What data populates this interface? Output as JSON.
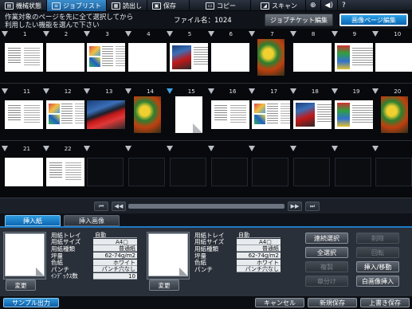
{
  "topbar": {
    "tabs": [
      {
        "label": "機械状態",
        "icon": "machine-status-icon"
      },
      {
        "label": "ジョブリスト",
        "icon": "job-list-icon"
      },
      {
        "label": "読出し",
        "icon": "recall-icon"
      },
      {
        "label": "保存",
        "icon": "save-icon"
      },
      {
        "label": "コピー",
        "icon": "copy-icon"
      },
      {
        "label": "スキャン",
        "icon": "scan-icon"
      }
    ],
    "globe_icon": "globe-icon",
    "volume_icon": "volume-icon",
    "help_icon": "help-icon"
  },
  "message": {
    "line1": "作業対象のページを先に全て選択してから",
    "line2": "利用したい機能を選んで下さい"
  },
  "file_name": "ファイル名：1024",
  "header_buttons": {
    "job_ticket": "ジョブチケット編集",
    "image_page": "画像ページ編集"
  },
  "pages": [
    {
      "num": "1",
      "kind": "text"
    },
    {
      "num": "2",
      "kind": "blank"
    },
    {
      "num": "3",
      "kind": "mix"
    },
    {
      "num": "4",
      "kind": "blank"
    },
    {
      "num": "5",
      "kind": "cartext"
    },
    {
      "num": "6",
      "kind": "blank"
    },
    {
      "num": "7",
      "kind": "dragon"
    },
    {
      "num": "8",
      "kind": "blank"
    },
    {
      "num": "9",
      "kind": "photoleft"
    },
    {
      "num": "10",
      "kind": "blank"
    },
    {
      "num": "11",
      "kind": "text"
    },
    {
      "num": "12",
      "kind": "mix"
    },
    {
      "num": "13",
      "kind": "car"
    },
    {
      "num": "14",
      "kind": "dragon"
    },
    {
      "num": "15",
      "kind": "curl"
    },
    {
      "num": "16",
      "kind": "text"
    },
    {
      "num": "17",
      "kind": "mix"
    },
    {
      "num": "18",
      "kind": "cartext"
    },
    {
      "num": "19",
      "kind": "photoleft"
    },
    {
      "num": "20",
      "kind": "dragon"
    },
    {
      "num": "21",
      "kind": "blank"
    },
    {
      "num": "22",
      "kind": "text"
    }
  ],
  "scroll": {
    "first": "⏮",
    "prev_page": "◀◀",
    "prev": "◀",
    "next": "▶",
    "next_page": "▶▶",
    "last": "⏭"
  },
  "lower_tabs": {
    "insert_paper": "挿入紙",
    "insert_image": "挿入画像"
  },
  "left_info": {
    "rows": [
      {
        "k": "用紙トレイ",
        "v": "自動"
      },
      {
        "k": "用紙サイズ",
        "v": "A4▢"
      },
      {
        "k": "用紙種類",
        "v": "普通紙"
      },
      {
        "k": "坪量",
        "v": "62-74g/m2"
      },
      {
        "k": "色紙",
        "v": "ホワイト"
      },
      {
        "k": "パンチ",
        "v": "パンチ穴なし"
      },
      {
        "k": "ｲﾝﾃﾞｯｸｽ数",
        "v": "10"
      }
    ],
    "change": "変更"
  },
  "right_info": {
    "rows": [
      {
        "k": "用紙トレイ",
        "v": "自動"
      },
      {
        "k": "用紙サイズ",
        "v": "A4▢"
      },
      {
        "k": "用紙種類",
        "v": "普通紙"
      },
      {
        "k": "坪量",
        "v": "62-74g/m2"
      },
      {
        "k": "色紙",
        "v": "ホワイト"
      },
      {
        "k": "パンチ",
        "v": "パンチ穴なし"
      }
    ],
    "change": "変更"
  },
  "action_buttons": {
    "continuous_select": "連続選択",
    "select_all": "全選択",
    "duplicate": "複製",
    "chapter": "章分け",
    "delete": "削除",
    "rotate": "回転",
    "insert_move": "挿入/移動",
    "blank_insert": "白画像挿入"
  },
  "footer": {
    "sample_print": "サンプル出力",
    "cancel": "キャンセル",
    "new_save": "新規保存",
    "overwrite_save": "上書き保存"
  }
}
